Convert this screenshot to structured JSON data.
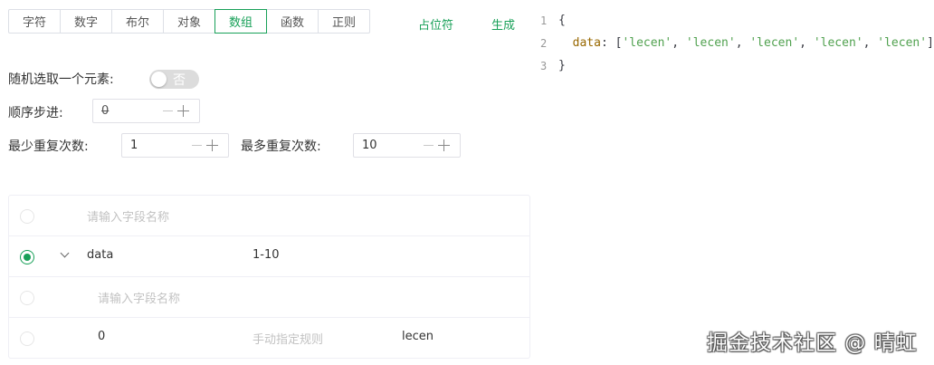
{
  "tabs": [
    {
      "label": "字符"
    },
    {
      "label": "数字"
    },
    {
      "label": "布尔"
    },
    {
      "label": "对象"
    },
    {
      "label": "数组",
      "active": true
    },
    {
      "label": "函数"
    },
    {
      "label": "正则"
    }
  ],
  "actions": {
    "placeholder_label": "占位符",
    "generate_label": "生成"
  },
  "form": {
    "random_pick_label": "随机选取一个元素:",
    "random_pick_value": "否",
    "order_step_label": "顺序步进:",
    "order_step_value": "0",
    "min_repeat_label": "最少重复次数:",
    "min_repeat_value": "1",
    "max_repeat_label": "最多重复次数:",
    "max_repeat_value": "10"
  },
  "code_preview": {
    "line_numbers": [
      "1",
      "2",
      "3"
    ],
    "open_brace": "{",
    "key": "data",
    "colon": ": [",
    "items": [
      "'lecen'",
      "'lecen'",
      "'lecen'",
      "'lecen'",
      "'lecen'"
    ],
    "separator": ", ",
    "close_bracket": "]",
    "close_brace": "}"
  },
  "tree": {
    "new_field_placeholder": "请输入字段名称",
    "rows": [
      {
        "name": "data",
        "range": "1-10"
      },
      {
        "child_placeholder": "请输入字段名称"
      },
      {
        "name": "0",
        "rule_placeholder": "手动指定规则",
        "value": "lecen"
      }
    ]
  },
  "watermark": "掘金技术社区 @ 晴虹",
  "colors": {
    "accent": "#18a058",
    "border": "#dcdfe6",
    "placeholder": "#c2c2c2"
  }
}
